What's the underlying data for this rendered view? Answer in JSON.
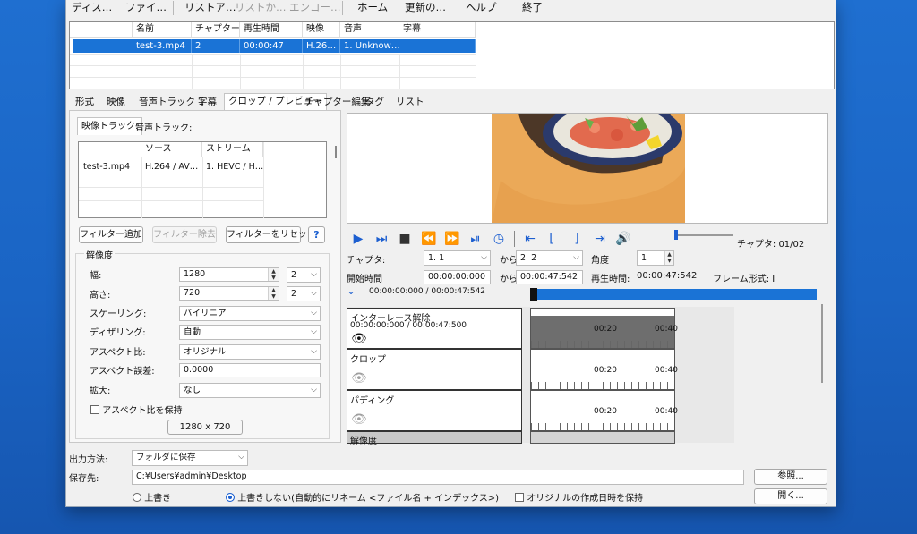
{
  "menu": {
    "display": "ディス…",
    "file": "ファイ…",
    "list": "リストア…",
    "list_disabled": "リストか…",
    "encode_disabled": "エンコー…",
    "home": "ホーム",
    "update": "更新の…",
    "help": "ヘルプ",
    "exit": "終了"
  },
  "file_list": {
    "headers": [
      "名前",
      "チャプター",
      "再生時間",
      "映像",
      "音声",
      "字幕"
    ],
    "rows": [
      [
        "test-3.mp4",
        "2",
        "00:00:47",
        "H.26…",
        "1. Unknow…",
        ""
      ]
    ]
  },
  "tabs": [
    "形式",
    "映像",
    "音声トラック 1",
    "字幕",
    "クロップ / プレビュー",
    "チャプター編集",
    "タグ",
    "リスト"
  ],
  "active_tab": "クロップ / プレビュー",
  "subtabs": [
    "映像トラック:",
    "音声トラック:"
  ],
  "track_table": {
    "headers": [
      "ソース",
      "ストリーム"
    ],
    "rows": [
      [
        "test-3.mp4",
        "H.264 / AV…",
        "1. HEVC / H…"
      ]
    ]
  },
  "filter_buttons": {
    "add": "フィルター追加",
    "remove": "フィルター除去",
    "reset": "フィルターをリセット",
    "help": "?"
  },
  "resolution": {
    "group_label": "解像度",
    "width_label": "幅:",
    "width_value": "1280",
    "width_step": "2",
    "height_label": "高さ:",
    "height_value": "720",
    "height_step": "2",
    "scaling_label": "スケーリング:",
    "scaling_value": "バイリニア",
    "dither_label": "ディザリング:",
    "dither_value": "自動",
    "aspect_label": "アスペクト比:",
    "aspect_value": "オリジナル",
    "aspect_error_label": "アスペクト誤差:",
    "aspect_error_value": "0.0000",
    "enlarge_label": "拡大:",
    "enlarge_value": "なし",
    "keep_aspect_label": "アスペクト比を保持",
    "size_display": "1280 x 720"
  },
  "controls": {
    "chapter_label": "チャプタ:",
    "chapter_from": "1. 1",
    "from_label": "から",
    "chapter_to": "2. 2",
    "angle_label": "角度",
    "angle_value": "1",
    "start_time_label": "開始時間",
    "start_time_value": "00:00:00:000",
    "end_time_value": "00:00:47:542",
    "duration_label": "再生時間:",
    "duration_value": "00:00:47:542",
    "frame_format_label": "フレーム形式: I",
    "chapter_counter": "チャプタ: 01/02",
    "position_text": "00:00:00:000 / 00:00:47:542",
    "progress": 0.0
  },
  "filters": [
    {
      "name": "インターレース解除",
      "time": "00:00:00:000 / 00:00:47:500"
    },
    {
      "name": "クロップ",
      "time": ""
    },
    {
      "name": "パディング",
      "time": ""
    },
    {
      "name": "解像度",
      "time": ""
    }
  ],
  "timeline_labels": [
    "00:20",
    "00:40"
  ],
  "output": {
    "method_label": "出力方法:",
    "method_value": "フォルダに保存",
    "dest_label": "保存先:",
    "dest_value": "C:¥Users¥admin¥Desktop",
    "browse_button": "参照...",
    "open_button": "開く...",
    "overwrite_label": "上書き",
    "no_overwrite_label": "上書きしない(自動的にリネーム <ファイル名 + インデックス>)",
    "keep_date_label": "オリジナルの作成日時を保持"
  },
  "colors": {
    "accent": "#1a73d6",
    "icon_blue": "#1d5fd0",
    "desktop": "#1f6fd0"
  }
}
